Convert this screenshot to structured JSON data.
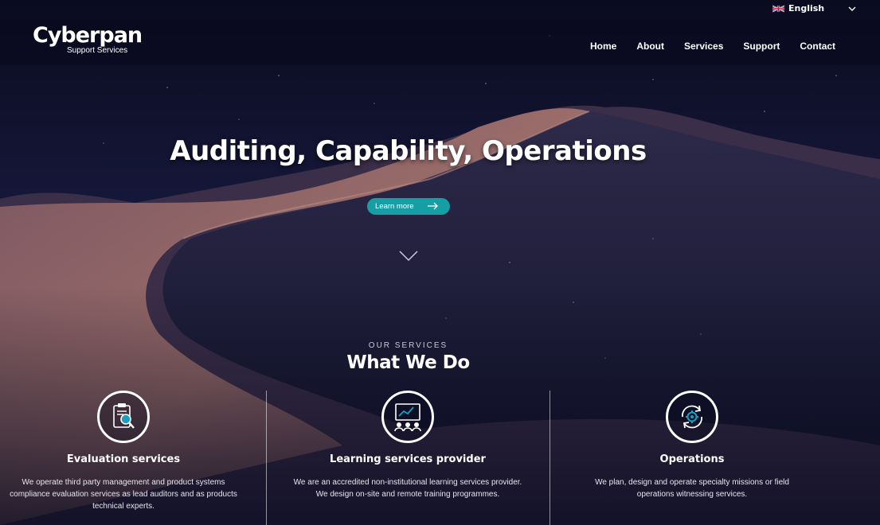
{
  "language": {
    "label": "English",
    "flag_icon": "uk-flag-icon"
  },
  "header": {
    "logo_main": "Cyberpan",
    "logo_sub": "Support Services",
    "nav": [
      "Home",
      "About",
      "Services",
      "Support",
      "Contact"
    ]
  },
  "hero": {
    "title": "Auditing, Capability, Operations",
    "cta_label": "Learn more",
    "accent_color": "#169ea5"
  },
  "services": {
    "eyebrow": "OUR SERVICES",
    "title": "What We Do",
    "items": [
      {
        "icon": "audit-clipboard-magnifier-icon",
        "title": "Evaluation services",
        "text": "We operate third party management and product systems compliance evaluation services as lead auditors and as products technical experts."
      },
      {
        "icon": "training-presentation-icon",
        "title": "Learning services provider",
        "text": "We are an accredited non-institutional learning services provider. We design on-site and remote training programmes."
      },
      {
        "icon": "operations-gear-cycle-icon",
        "title": "Operations",
        "text": "We plan, design and operate specialty missions or field operations witnessing services."
      }
    ]
  }
}
